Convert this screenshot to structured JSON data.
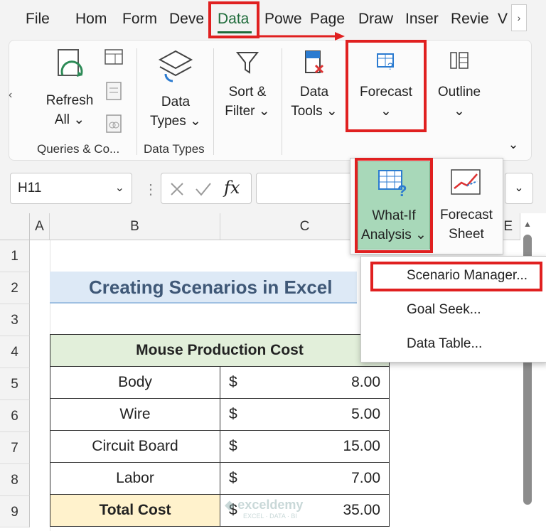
{
  "tabs": [
    {
      "label": "File"
    },
    {
      "label": "Hom"
    },
    {
      "label": "Form"
    },
    {
      "label": "Deve"
    },
    {
      "label": "Data"
    },
    {
      "label": "Powe"
    },
    {
      "label": "Page"
    },
    {
      "label": "Draw"
    },
    {
      "label": "Inser"
    },
    {
      "label": "Revie"
    },
    {
      "label": "V"
    }
  ],
  "ribbon": {
    "refresh_all": {
      "line1": "Refresh",
      "line2": "All ⌄"
    },
    "data_types": {
      "line1": "Data",
      "line2": "Types ⌄"
    },
    "sort_filter": {
      "line1": "Sort &",
      "line2": "Filter ⌄"
    },
    "data_tools": {
      "line1": "Data",
      "line2": "Tools ⌄"
    },
    "forecast": {
      "line1": "Forecast",
      "line2": "⌄"
    },
    "outline": {
      "line1": "Outline",
      "line2": "⌄"
    },
    "group_queries": "Queries & Co...",
    "group_data_types": "Data Types"
  },
  "formula_bar": {
    "name_box": "H11",
    "fx": "fx"
  },
  "columns": [
    {
      "label": "A"
    },
    {
      "label": "B"
    },
    {
      "label": "C"
    },
    {
      "label": "E"
    }
  ],
  "rows": [
    "1",
    "2",
    "3",
    "4",
    "5",
    "6",
    "7",
    "8",
    "9"
  ],
  "sheet": {
    "title": "Creating Scenarios in Excel",
    "table_header": "Mouse Production Cost",
    "items": [
      {
        "name": "Body",
        "currency": "$",
        "amount": "8.00"
      },
      {
        "name": "Wire",
        "currency": "$",
        "amount": "5.00"
      },
      {
        "name": "Circuit Board",
        "currency": "$",
        "amount": "15.00"
      },
      {
        "name": "Labor",
        "currency": "$",
        "amount": "7.00"
      }
    ],
    "total": {
      "name": "Total Cost",
      "currency": "$",
      "amount": "35.00"
    }
  },
  "forecast_panel": {
    "whatif": {
      "line1": "What-If",
      "line2": "Analysis ⌄"
    },
    "forecast_sheet": {
      "line1": "Forecast",
      "line2": "Sheet"
    }
  },
  "whatif_menu": {
    "items": [
      {
        "label": "Scenario Manager..."
      },
      {
        "label": "Goal Seek..."
      },
      {
        "label": "Data Table..."
      }
    ]
  },
  "watermark": "exceldemy",
  "watermark_sub": "EXCEL · DATA · BI",
  "colors": {
    "accent_green": "#1e6b3a",
    "highlight_red": "#e02020",
    "whatif_bg": "#a8d8b9",
    "title_bg": "#dde9f6",
    "header_bg": "#e2efda",
    "total_bg": "#fff2cc"
  }
}
